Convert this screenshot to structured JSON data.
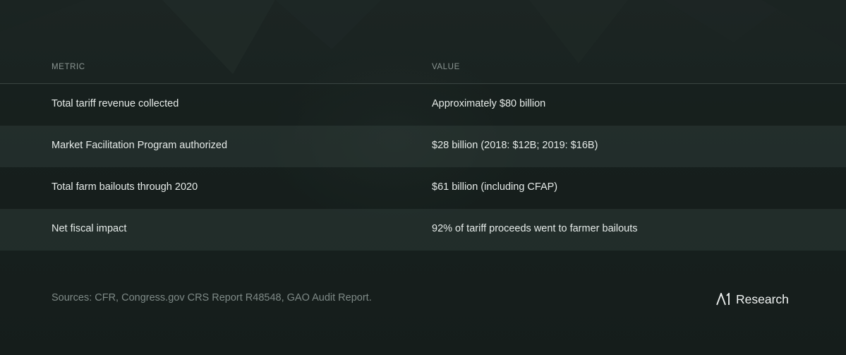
{
  "table": {
    "headers": {
      "metric": "METRIC",
      "value": "VALUE"
    },
    "rows": [
      {
        "metric": "Total tariff revenue collected",
        "value": "Approximately $80 billion"
      },
      {
        "metric": "Market Facilitation Program authorized",
        "value": "$28 billion (2018: $12B; 2019: $16B)"
      },
      {
        "metric": "Total farm bailouts through 2020",
        "value": "$61 billion (including CFAP)"
      },
      {
        "metric": "Net fiscal impact",
        "value": "92% of tariff proceeds went to farmer bailouts"
      }
    ]
  },
  "footer": {
    "sources": "Sources: CFR, Congress.gov CRS Report R48548, GAO Audit Report.",
    "brand": "Research",
    "brand_logo_icon": "a1-logo-icon"
  }
}
